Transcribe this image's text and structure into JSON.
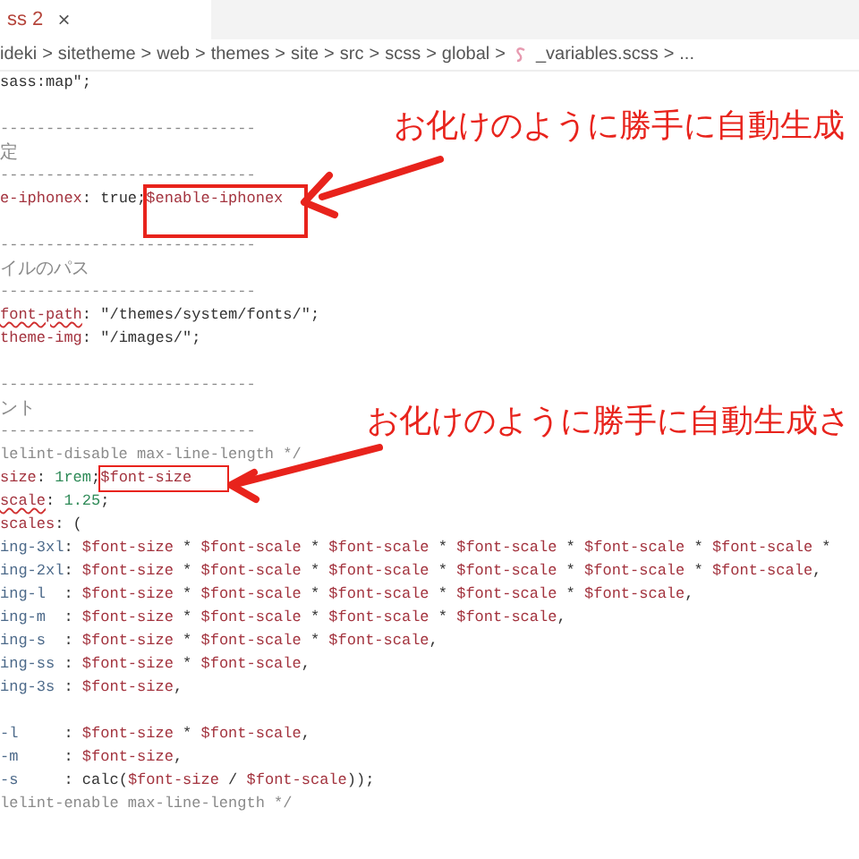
{
  "tab": {
    "title": "ss 2",
    "close": "×",
    "selected": true
  },
  "breadcrumb": [
    {
      "text": "ideki"
    },
    {
      "text": "sitetheme"
    },
    {
      "text": "web"
    },
    {
      "text": "themes"
    },
    {
      "text": "site"
    },
    {
      "text": "src"
    },
    {
      "text": "scss"
    },
    {
      "text": "global"
    },
    {
      "text": "_variables.scss",
      "kind": "file"
    },
    {
      "text": "..."
    }
  ],
  "breadcrumb_separator": ">",
  "code_lines": [
    {
      "kind": "code",
      "tokens": [
        {
          "kind": "str",
          "text": "sass:map\""
        },
        {
          "kind": "plain",
          "text": ";"
        }
      ]
    },
    {
      "kind": "blank"
    },
    {
      "kind": "code",
      "tokens": [
        {
          "kind": "comment",
          "text": "----------------------------"
        }
      ]
    },
    {
      "kind": "code",
      "tokens": [
        {
          "kind": "comment",
          "text": "定"
        }
      ]
    },
    {
      "kind": "code",
      "tokens": [
        {
          "kind": "comment",
          "text": "----------------------------"
        }
      ]
    },
    {
      "kind": "code",
      "tokens": [
        {
          "kind": "var",
          "text": "e-iphonex"
        },
        {
          "kind": "plain",
          "text": ": true;"
        },
        {
          "kind": "var",
          "text": "$enable-iphonex"
        }
      ]
    },
    {
      "kind": "blank"
    },
    {
      "kind": "code",
      "tokens": [
        {
          "kind": "comment",
          "text": "----------------------------"
        }
      ]
    },
    {
      "kind": "code",
      "tokens": [
        {
          "kind": "comment",
          "text": "イルのパス"
        }
      ]
    },
    {
      "kind": "code",
      "tokens": [
        {
          "kind": "comment",
          "text": "----------------------------"
        }
      ]
    },
    {
      "kind": "code",
      "tokens": [
        {
          "kind": "var",
          "text": "font-path",
          "squiggle": true
        },
        {
          "kind": "plain",
          "text": ": \"/themes/system/fonts/\";"
        }
      ]
    },
    {
      "kind": "code",
      "tokens": [
        {
          "kind": "var",
          "text": "theme-img"
        },
        {
          "kind": "plain",
          "text": ": \"/images/\";"
        }
      ]
    },
    {
      "kind": "blank"
    },
    {
      "kind": "code",
      "tokens": [
        {
          "kind": "comment",
          "text": "----------------------------"
        }
      ]
    },
    {
      "kind": "code",
      "tokens": [
        {
          "kind": "comment",
          "text": "ント"
        }
      ]
    },
    {
      "kind": "code",
      "tokens": [
        {
          "kind": "comment",
          "text": "----------------------------"
        }
      ]
    },
    {
      "kind": "code",
      "tokens": [
        {
          "kind": "comment",
          "text": "lelint-disable max-line-length */"
        }
      ]
    },
    {
      "kind": "code",
      "tokens": [
        {
          "kind": "var",
          "text": "size"
        },
        {
          "kind": "plain",
          "text": ": "
        },
        {
          "kind": "num",
          "text": "1rem"
        },
        {
          "kind": "plain",
          "text": ";"
        },
        {
          "kind": "var",
          "text": "$font-size"
        }
      ]
    },
    {
      "kind": "code",
      "tokens": [
        {
          "kind": "var",
          "text": "scale",
          "squiggle": true
        },
        {
          "kind": "plain",
          "text": ": "
        },
        {
          "kind": "num",
          "text": "1.25"
        },
        {
          "kind": "plain",
          "text": ";"
        }
      ]
    },
    {
      "kind": "code",
      "tokens": [
        {
          "kind": "var",
          "text": "scales"
        },
        {
          "kind": "plain",
          "text": ": ("
        }
      ]
    },
    {
      "kind": "code",
      "tokens": [
        {
          "kind": "prop",
          "text": "ing-3xl"
        },
        {
          "kind": "plain",
          "text": ": "
        },
        {
          "kind": "var",
          "text": "$font-size"
        },
        {
          "kind": "plain",
          "text": " * "
        },
        {
          "kind": "var",
          "text": "$font-scale"
        },
        {
          "kind": "plain",
          "text": " * "
        },
        {
          "kind": "var",
          "text": "$font-scale"
        },
        {
          "kind": "plain",
          "text": " * "
        },
        {
          "kind": "var",
          "text": "$font-scale"
        },
        {
          "kind": "plain",
          "text": " * "
        },
        {
          "kind": "var",
          "text": "$font-scale"
        },
        {
          "kind": "plain",
          "text": " * "
        },
        {
          "kind": "var",
          "text": "$font-scale"
        },
        {
          "kind": "plain",
          "text": " *"
        }
      ]
    },
    {
      "kind": "code",
      "tokens": [
        {
          "kind": "prop",
          "text": "ing-2xl"
        },
        {
          "kind": "plain",
          "text": ": "
        },
        {
          "kind": "var",
          "text": "$font-size"
        },
        {
          "kind": "plain",
          "text": " * "
        },
        {
          "kind": "var",
          "text": "$font-scale"
        },
        {
          "kind": "plain",
          "text": " * "
        },
        {
          "kind": "var",
          "text": "$font-scale"
        },
        {
          "kind": "plain",
          "text": " * "
        },
        {
          "kind": "var",
          "text": "$font-scale"
        },
        {
          "kind": "plain",
          "text": " * "
        },
        {
          "kind": "var",
          "text": "$font-scale"
        },
        {
          "kind": "plain",
          "text": " * "
        },
        {
          "kind": "var",
          "text": "$font-scale"
        },
        {
          "kind": "plain",
          "text": ","
        }
      ]
    },
    {
      "kind": "code",
      "tokens": [
        {
          "kind": "prop",
          "text": "ing-l  "
        },
        {
          "kind": "plain",
          "text": ": "
        },
        {
          "kind": "var",
          "text": "$font-size"
        },
        {
          "kind": "plain",
          "text": " * "
        },
        {
          "kind": "var",
          "text": "$font-scale"
        },
        {
          "kind": "plain",
          "text": " * "
        },
        {
          "kind": "var",
          "text": "$font-scale"
        },
        {
          "kind": "plain",
          "text": " * "
        },
        {
          "kind": "var",
          "text": "$font-scale"
        },
        {
          "kind": "plain",
          "text": " * "
        },
        {
          "kind": "var",
          "text": "$font-scale"
        },
        {
          "kind": "plain",
          "text": ","
        }
      ]
    },
    {
      "kind": "code",
      "tokens": [
        {
          "kind": "prop",
          "text": "ing-m  "
        },
        {
          "kind": "plain",
          "text": ": "
        },
        {
          "kind": "var",
          "text": "$font-size"
        },
        {
          "kind": "plain",
          "text": " * "
        },
        {
          "kind": "var",
          "text": "$font-scale"
        },
        {
          "kind": "plain",
          "text": " * "
        },
        {
          "kind": "var",
          "text": "$font-scale"
        },
        {
          "kind": "plain",
          "text": " * "
        },
        {
          "kind": "var",
          "text": "$font-scale"
        },
        {
          "kind": "plain",
          "text": ","
        }
      ]
    },
    {
      "kind": "code",
      "tokens": [
        {
          "kind": "prop",
          "text": "ing-s  "
        },
        {
          "kind": "plain",
          "text": ": "
        },
        {
          "kind": "var",
          "text": "$font-size"
        },
        {
          "kind": "plain",
          "text": " * "
        },
        {
          "kind": "var",
          "text": "$font-scale"
        },
        {
          "kind": "plain",
          "text": " * "
        },
        {
          "kind": "var",
          "text": "$font-scale"
        },
        {
          "kind": "plain",
          "text": ","
        }
      ]
    },
    {
      "kind": "code",
      "tokens": [
        {
          "kind": "prop",
          "text": "ing-ss "
        },
        {
          "kind": "plain",
          "text": ": "
        },
        {
          "kind": "var",
          "text": "$font-size"
        },
        {
          "kind": "plain",
          "text": " * "
        },
        {
          "kind": "var",
          "text": "$font-scale"
        },
        {
          "kind": "plain",
          "text": ","
        }
      ]
    },
    {
      "kind": "code",
      "tokens": [
        {
          "kind": "prop",
          "text": "ing-3s "
        },
        {
          "kind": "plain",
          "text": ": "
        },
        {
          "kind": "var",
          "text": "$font-size"
        },
        {
          "kind": "plain",
          "text": ","
        }
      ]
    },
    {
      "kind": "blank"
    },
    {
      "kind": "code",
      "tokens": [
        {
          "kind": "prop",
          "text": "-l     "
        },
        {
          "kind": "plain",
          "text": ": "
        },
        {
          "kind": "var",
          "text": "$font-size"
        },
        {
          "kind": "plain",
          "text": " * "
        },
        {
          "kind": "var",
          "text": "$font-scale"
        },
        {
          "kind": "plain",
          "text": ","
        }
      ]
    },
    {
      "kind": "code",
      "tokens": [
        {
          "kind": "prop",
          "text": "-m     "
        },
        {
          "kind": "plain",
          "text": ": "
        },
        {
          "kind": "var",
          "text": "$font-size"
        },
        {
          "kind": "plain",
          "text": ","
        }
      ]
    },
    {
      "kind": "code",
      "tokens": [
        {
          "kind": "prop",
          "text": "-s     "
        },
        {
          "kind": "plain",
          "text": ": calc("
        },
        {
          "kind": "var",
          "text": "$font-size"
        },
        {
          "kind": "plain",
          "text": " / "
        },
        {
          "kind": "var",
          "text": "$font-scale"
        },
        {
          "kind": "plain",
          "text": "));"
        }
      ]
    },
    {
      "kind": "code",
      "tokens": [
        {
          "kind": "comment",
          "text": "lelint-enable max-line-length */"
        }
      ]
    }
  ],
  "annotations": [
    {
      "text": "お化けのように勝手に自動生成"
    },
    {
      "text": "お化けのように勝手に自動生成さ"
    }
  ]
}
